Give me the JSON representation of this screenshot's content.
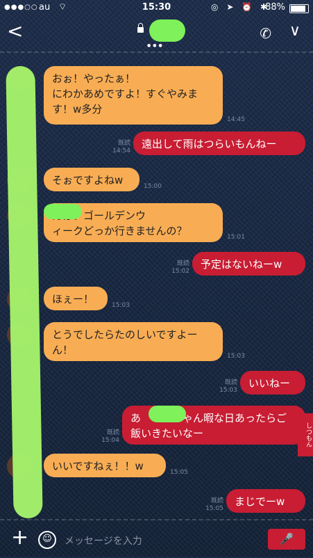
{
  "status_bar": {
    "signal": "●●●○○",
    "carrier": "au",
    "wifi": "⌔",
    "time": "15:30",
    "icons": "◎ ➤ ⏰ ✱",
    "battery": "88%",
    "battery_level": 0.88
  },
  "header": {
    "back": "<",
    "pager": "●●●",
    "call": "✆",
    "expand": "∨"
  },
  "messages": [
    {
      "dir": "in",
      "text": "おぉ！やったぁ！\nにわかあめですよ！すぐやみま\nす！w多分",
      "time": "14:45",
      "read": ""
    },
    {
      "dir": "out",
      "text": "遠出して雨はつらいもんねー",
      "time": "14:54",
      "read": "既読"
    },
    {
      "dir": "in",
      "text": "そぉですよねw",
      "time": "15:00",
      "read": ""
    },
    {
      "dir": "in",
      "text": "んは、ゴールデンウ\nィークどっか行きませんの？",
      "time": "15:01",
      "read": ""
    },
    {
      "dir": "out",
      "text": "予定はないねーw",
      "time": "15:02",
      "read": "既読"
    },
    {
      "dir": "in",
      "text": "ほぇー！",
      "time": "15:03",
      "read": ""
    },
    {
      "dir": "in",
      "text": "とうでしたらたのしいですよー\nん！",
      "time": "15:03",
      "read": ""
    },
    {
      "dir": "out",
      "text": "いいねー",
      "time": "15:03",
      "read": "既読"
    },
    {
      "dir": "out",
      "text": "あ　　　ちゃん暇な日あったらご\n飯いきたいなー",
      "time": "15:04",
      "read": "既読"
    },
    {
      "dir": "in",
      "text": "いいですねぇ！！w",
      "time": "15:05",
      "read": ""
    },
    {
      "dir": "out",
      "text": "まじでーw",
      "time": "15:05",
      "read": "既読"
    }
  ],
  "side_tab": "しつもん",
  "composer": {
    "plus": "+",
    "emoji": "☺",
    "placeholder": "メッセージを入力",
    "mic": "🎤"
  }
}
